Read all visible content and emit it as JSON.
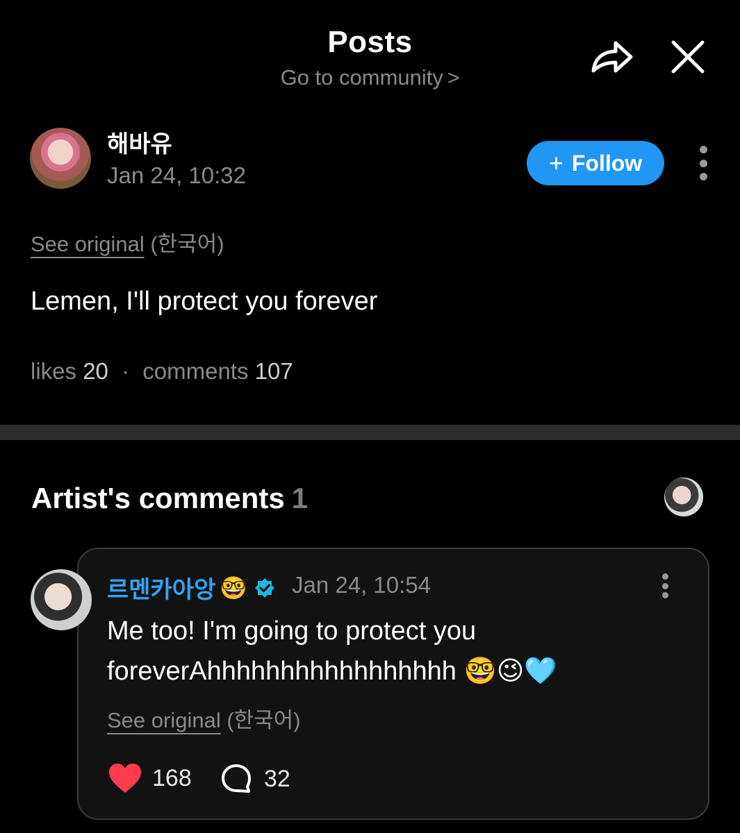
{
  "header": {
    "title": "Posts",
    "subtitle": "Go to community",
    "subtitle_chevron": ">"
  },
  "post": {
    "author": "해바유",
    "timestamp": "Jan 24, 10:32",
    "follow_label": "Follow",
    "see_original": "See original",
    "original_lang": "(한국어)",
    "body": "Lemen, I'll protect you forever",
    "likes_label": "likes",
    "likes_count": "20",
    "separator": "·",
    "comments_label": "comments",
    "comments_count": "107"
  },
  "artist_comments": {
    "title": "Artist's comments",
    "count": "1",
    "comment": {
      "author": "르멘카아앙",
      "author_emoji": "🤓",
      "timestamp": "Jan 24, 10:54",
      "body": "Me too! I'm going to protect you foreverAhhhhhhhhhhhhhhhhh 🤓😉🩵",
      "see_original": "See original",
      "original_lang": "(한국어)",
      "like_count": "168",
      "reply_count": "32"
    }
  },
  "colors": {
    "background": "#000000",
    "accent_blue": "#2196f3",
    "artist_name": "#2fa4f5",
    "heart": "#ff3b4e",
    "muted_text": "#8a8a8a",
    "verified_badge": "#1fb6e0"
  },
  "icons": [
    "share-icon",
    "close-icon",
    "plus-icon",
    "more-vertical-icon",
    "verified-badge-icon",
    "heart-icon",
    "comment-bubble-icon"
  ]
}
